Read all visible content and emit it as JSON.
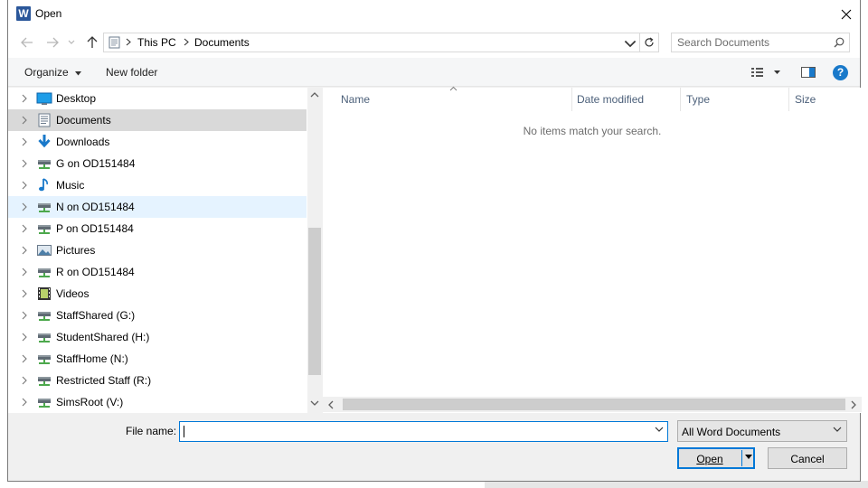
{
  "dialog": {
    "title": "Open",
    "app_icon_letter": "W",
    "accent": "#0078d7"
  },
  "navigation": {
    "breadcrumbs": [
      "This PC",
      "Documents"
    ],
    "search_placeholder": "Search Documents"
  },
  "toolbar": {
    "organize_label": "Organize",
    "new_folder_label": "New folder",
    "help_label": "?"
  },
  "tree": {
    "items": [
      {
        "label": "Desktop",
        "icon": "desktop-icon"
      },
      {
        "label": "Documents",
        "icon": "documents-icon",
        "selected": true
      },
      {
        "label": "Downloads",
        "icon": "downloads-icon"
      },
      {
        "label": "G on OD151484",
        "icon": "network-drive-icon"
      },
      {
        "label": "Music",
        "icon": "music-icon"
      },
      {
        "label": "N on OD151484",
        "icon": "network-drive-icon",
        "hover": true
      },
      {
        "label": "P on OD151484",
        "icon": "network-drive-icon"
      },
      {
        "label": "Pictures",
        "icon": "pictures-icon"
      },
      {
        "label": "R on OD151484",
        "icon": "network-drive-icon"
      },
      {
        "label": "Videos",
        "icon": "videos-icon"
      },
      {
        "label": "StaffShared (G:)",
        "icon": "network-drive-icon"
      },
      {
        "label": "StudentShared (H:)",
        "icon": "network-drive-icon"
      },
      {
        "label": "StaffHome (N:)",
        "icon": "network-drive-icon"
      },
      {
        "label": "Restricted Staff (R:)",
        "icon": "network-drive-icon"
      },
      {
        "label": "SimsRoot (V:)",
        "icon": "network-drive-icon"
      }
    ]
  },
  "content": {
    "columns": [
      "Name",
      "Date modified",
      "Type",
      "Size"
    ],
    "empty_message": "No items match your search."
  },
  "footer": {
    "file_name_label": "File name:",
    "file_name_value": "",
    "file_type_value": "All Word Documents",
    "open_label": "Open",
    "cancel_label": "Cancel"
  }
}
